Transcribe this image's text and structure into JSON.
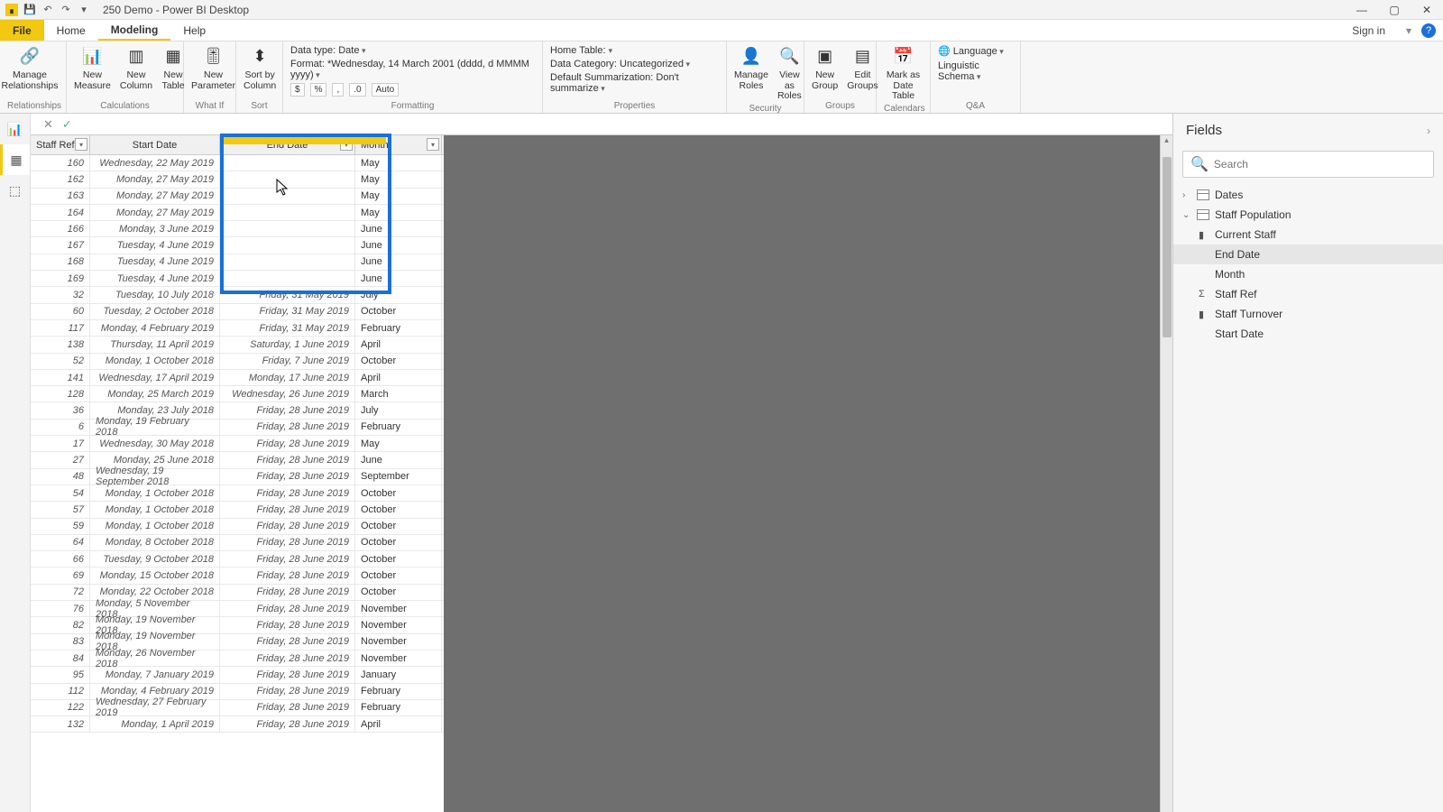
{
  "window": {
    "title": "250 Demo - Power BI Desktop",
    "signin": "Sign in"
  },
  "menu": {
    "file": "File",
    "tabs": [
      "Home",
      "Modeling",
      "Help"
    ],
    "active": "Modeling"
  },
  "ribbon": {
    "groups": {
      "relationships": {
        "title": "Relationships",
        "manage": "Manage\nRelationships"
      },
      "calculations": {
        "title": "Calculations",
        "measure": "New\nMeasure",
        "column": "New\nColumn",
        "table": "New\nTable"
      },
      "whatif": {
        "title": "What If",
        "param": "New\nParameter"
      },
      "sort": {
        "title": "Sort",
        "sortby": "Sort by\nColumn"
      },
      "formatting": {
        "title": "Formatting",
        "datatype_label": "Data type:",
        "datatype_value": "Date",
        "format_label": "Format:",
        "format_value": "*Wednesday, 14 March 2001 (dddd, d MMMM yyyy)",
        "currency": "$",
        "percent": "%",
        "thousands": ",",
        "decimals": ".0",
        "auto": "Auto"
      },
      "properties": {
        "title": "Properties",
        "hometable_label": "Home Table:",
        "hometable_value": "",
        "datacat_label": "Data Category:",
        "datacat_value": "Uncategorized",
        "summ_label": "Default Summarization:",
        "summ_value": "Don't summarize"
      },
      "security": {
        "title": "Security",
        "manage": "Manage\nRoles",
        "view": "View as\nRoles"
      },
      "groupsg": {
        "title": "Groups",
        "new": "New\nGroup",
        "edit": "Edit\nGroups"
      },
      "calendars": {
        "title": "Calendars",
        "mark": "Mark as\nDate Table"
      },
      "qa": {
        "title": "Q&A",
        "lang": "Language",
        "schema": "Linguistic Schema"
      }
    }
  },
  "grid": {
    "columns": [
      "Staff Ref",
      "Start Date",
      "End Date",
      "Month"
    ],
    "rows": [
      {
        "ref": "160",
        "start": "Wednesday, 22 May 2019",
        "end": "",
        "month": "May"
      },
      {
        "ref": "162",
        "start": "Monday, 27 May 2019",
        "end": "",
        "month": "May"
      },
      {
        "ref": "163",
        "start": "Monday, 27 May 2019",
        "end": "",
        "month": "May"
      },
      {
        "ref": "164",
        "start": "Monday, 27 May 2019",
        "end": "",
        "month": "May"
      },
      {
        "ref": "166",
        "start": "Monday, 3 June 2019",
        "end": "",
        "month": "June"
      },
      {
        "ref": "167",
        "start": "Tuesday, 4 June 2019",
        "end": "",
        "month": "June"
      },
      {
        "ref": "168",
        "start": "Tuesday, 4 June 2019",
        "end": "",
        "month": "June"
      },
      {
        "ref": "169",
        "start": "Tuesday, 4 June 2019",
        "end": "",
        "month": "June"
      },
      {
        "ref": "32",
        "start": "Tuesday, 10 July 2018",
        "end": "Friday, 31 May 2019",
        "month": "July"
      },
      {
        "ref": "60",
        "start": "Tuesday, 2 October 2018",
        "end": "Friday, 31 May 2019",
        "month": "October"
      },
      {
        "ref": "117",
        "start": "Monday, 4 February 2019",
        "end": "Friday, 31 May 2019",
        "month": "February"
      },
      {
        "ref": "138",
        "start": "Thursday, 11 April 2019",
        "end": "Saturday, 1 June 2019",
        "month": "April"
      },
      {
        "ref": "52",
        "start": "Monday, 1 October 2018",
        "end": "Friday, 7 June 2019",
        "month": "October"
      },
      {
        "ref": "141",
        "start": "Wednesday, 17 April 2019",
        "end": "Monday, 17 June 2019",
        "month": "April"
      },
      {
        "ref": "128",
        "start": "Monday, 25 March 2019",
        "end": "Wednesday, 26 June 2019",
        "month": "March"
      },
      {
        "ref": "36",
        "start": "Monday, 23 July 2018",
        "end": "Friday, 28 June 2019",
        "month": "July"
      },
      {
        "ref": "6",
        "start": "Monday, 19 February 2018",
        "end": "Friday, 28 June 2019",
        "month": "February"
      },
      {
        "ref": "17",
        "start": "Wednesday, 30 May 2018",
        "end": "Friday, 28 June 2019",
        "month": "May"
      },
      {
        "ref": "27",
        "start": "Monday, 25 June 2018",
        "end": "Friday, 28 June 2019",
        "month": "June"
      },
      {
        "ref": "48",
        "start": "Wednesday, 19 September 2018",
        "end": "Friday, 28 June 2019",
        "month": "September"
      },
      {
        "ref": "54",
        "start": "Monday, 1 October 2018",
        "end": "Friday, 28 June 2019",
        "month": "October"
      },
      {
        "ref": "57",
        "start": "Monday, 1 October 2018",
        "end": "Friday, 28 June 2019",
        "month": "October"
      },
      {
        "ref": "59",
        "start": "Monday, 1 October 2018",
        "end": "Friday, 28 June 2019",
        "month": "October"
      },
      {
        "ref": "64",
        "start": "Monday, 8 October 2018",
        "end": "Friday, 28 June 2019",
        "month": "October"
      },
      {
        "ref": "66",
        "start": "Tuesday, 9 October 2018",
        "end": "Friday, 28 June 2019",
        "month": "October"
      },
      {
        "ref": "69",
        "start": "Monday, 15 October 2018",
        "end": "Friday, 28 June 2019",
        "month": "October"
      },
      {
        "ref": "72",
        "start": "Monday, 22 October 2018",
        "end": "Friday, 28 June 2019",
        "month": "October"
      },
      {
        "ref": "76",
        "start": "Monday, 5 November 2018",
        "end": "Friday, 28 June 2019",
        "month": "November"
      },
      {
        "ref": "82",
        "start": "Monday, 19 November 2018",
        "end": "Friday, 28 June 2019",
        "month": "November"
      },
      {
        "ref": "83",
        "start": "Monday, 19 November 2018",
        "end": "Friday, 28 June 2019",
        "month": "November"
      },
      {
        "ref": "84",
        "start": "Monday, 26 November 2018",
        "end": "Friday, 28 June 2019",
        "month": "November"
      },
      {
        "ref": "95",
        "start": "Monday, 7 January 2019",
        "end": "Friday, 28 June 2019",
        "month": "January"
      },
      {
        "ref": "112",
        "start": "Monday, 4 February 2019",
        "end": "Friday, 28 June 2019",
        "month": "February"
      },
      {
        "ref": "122",
        "start": "Wednesday, 27 February 2019",
        "end": "Friday, 28 June 2019",
        "month": "February"
      },
      {
        "ref": "132",
        "start": "Monday, 1 April 2019",
        "end": "Friday, 28 June 2019",
        "month": "April"
      }
    ]
  },
  "fields": {
    "title": "Fields",
    "search_placeholder": "Search",
    "tables": [
      {
        "name": "Dates",
        "expanded": false,
        "fields": []
      },
      {
        "name": "Staff Population",
        "expanded": true,
        "fields": [
          {
            "name": "Current Staff",
            "icon": "measure"
          },
          {
            "name": "End Date",
            "icon": "",
            "selected": true
          },
          {
            "name": "Month",
            "icon": ""
          },
          {
            "name": "Staff Ref",
            "icon": "sigma"
          },
          {
            "name": "Staff Turnover",
            "icon": "measure"
          },
          {
            "name": "Start Date",
            "icon": ""
          }
        ]
      }
    ]
  }
}
